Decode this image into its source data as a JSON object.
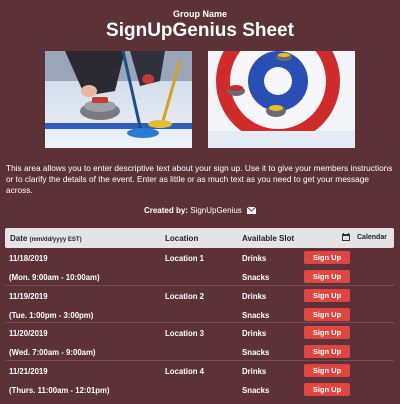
{
  "header": {
    "group_name": "Group Name",
    "title": "SignUpGenius Sheet"
  },
  "images": [
    {
      "name": "curling-sweeping-photo"
    },
    {
      "name": "curling-house-photo"
    }
  ],
  "description": "This area allows you to enter descriptive text about your sign up. Use it to give your members instructions or to clarify the details of the event. Enter as little or as much text as you need to get your message across.",
  "created_by": {
    "label": "Created by:",
    "name": "SignUpGenius",
    "icon": "envelope-icon"
  },
  "table": {
    "headers": {
      "date": "Date",
      "date_format": "(mm/dd/yyyy EST)",
      "location": "Location",
      "slot": "Available Slot",
      "calendar": "Calendar"
    },
    "button_label": "Sign Up",
    "rows": [
      {
        "date": "11/18/2019",
        "time": "(Mon. 9:00am - 10:00am)",
        "location": "Location 1",
        "slots": [
          "Drinks",
          "Snacks"
        ]
      },
      {
        "date": "11/19/2019",
        "time": "(Tue. 1:00pm - 3:00pm)",
        "location": "Location 2",
        "slots": [
          "Drinks",
          "Snacks"
        ]
      },
      {
        "date": "11/20/2019",
        "time": "(Wed. 7:00am - 9:00am)",
        "location": "Location 3",
        "slots": [
          "Drinks",
          "Snacks"
        ]
      },
      {
        "date": "11/21/2019",
        "time": "(Thurs. 11:00am - 12:01pm)",
        "location": "Location 4",
        "slots": [
          "Drinks",
          "Snacks"
        ]
      }
    ]
  },
  "colors": {
    "background": "#5c3238",
    "header_bar": "#e4e4e4",
    "button": "#e0463f"
  }
}
